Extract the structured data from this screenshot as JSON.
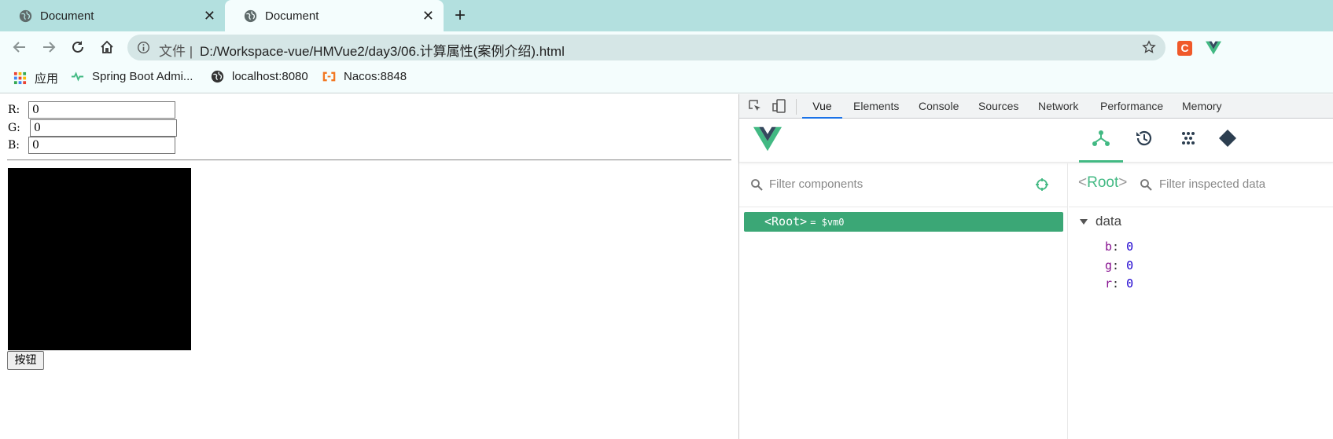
{
  "browser": {
    "tabs": [
      {
        "title": "Document",
        "active": false
      },
      {
        "title": "Document",
        "active": true
      }
    ],
    "address": {
      "prefix": "文件 |",
      "url": "D:/Workspace-vue/HMVue2/day3/06.计算属性(案例介绍).html"
    },
    "extensions": {
      "c_label": "C"
    },
    "bookmarks": [
      {
        "label": "应用",
        "icon": "apps-grid-icon"
      },
      {
        "label": "Spring Boot Admi...",
        "icon": "heartbeat-icon"
      },
      {
        "label": "localhost:8080",
        "icon": "globe-icon"
      },
      {
        "label": "Nacos:8848",
        "icon": "nacos-icon"
      }
    ]
  },
  "page": {
    "fields": [
      {
        "label": "R:",
        "value": "0"
      },
      {
        "label": "G:",
        "value": "0"
      },
      {
        "label": "B:",
        "value": "0"
      }
    ],
    "box_color": "#000000",
    "button_label": "按钮"
  },
  "devtools": {
    "tabs": [
      "Vue",
      "Elements",
      "Console",
      "Sources",
      "Network",
      "Performance",
      "Memory"
    ],
    "active_tab": "Vue",
    "components_filter_placeholder": "Filter components",
    "root_label": "<Root>",
    "root_vm": "= $vm0",
    "inspector": {
      "title": "Root",
      "filter_placeholder": "Filter inspected data",
      "section": "data",
      "props": [
        {
          "key": "b",
          "value": "0"
        },
        {
          "key": "g",
          "value": "0"
        },
        {
          "key": "r",
          "value": "0"
        }
      ]
    },
    "accent_color": "#42b983"
  }
}
